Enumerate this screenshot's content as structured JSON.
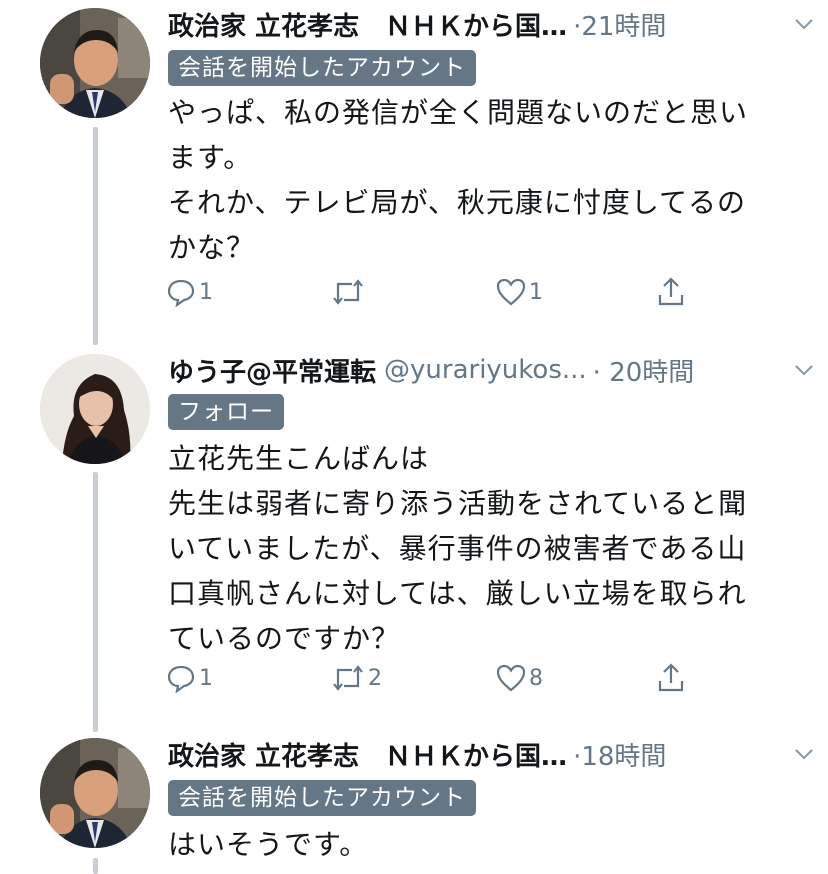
{
  "colors": {
    "text": "#14171a",
    "secondary": "#657786",
    "thread_line": "#c4cfd6",
    "badge_bg": "#657786"
  },
  "tweets": [
    {
      "author_name": "政治家 立花孝志　ＮＨＫから国…",
      "handle": "",
      "time": "·21時間",
      "badge": "会話を開始したアカウント",
      "text": "やっぱ、私の発信が全く問題ないのだと思い\nます。\nそれか、テレビ局が、秋元康に忖度してるの\nかな？",
      "reply_count": "1",
      "retweet_count": "",
      "like_count": "1",
      "avatar_icon": "avatar-man-icon"
    },
    {
      "author_name": "ゆう子@平常運転",
      "handle": "@yurariyukos...",
      "time": "· 20時間",
      "badge": "フォロー",
      "text": "立花先生こんばんは\n先生は弱者に寄り添う活動をされていると聞\nいていましたが、暴行事件の被害者である山\n口真帆さんに対しては、厳しい立場を取られ\nているのですか？",
      "reply_count": "1",
      "retweet_count": "2",
      "like_count": "8",
      "avatar_icon": "avatar-woman-icon"
    },
    {
      "author_name": "政治家 立花孝志　ＮＨＫから国…",
      "handle": "",
      "time": "·18時間",
      "badge": "会話を開始したアカウント",
      "text": "はいそうです。",
      "avatar_icon": "avatar-man-icon"
    }
  ]
}
